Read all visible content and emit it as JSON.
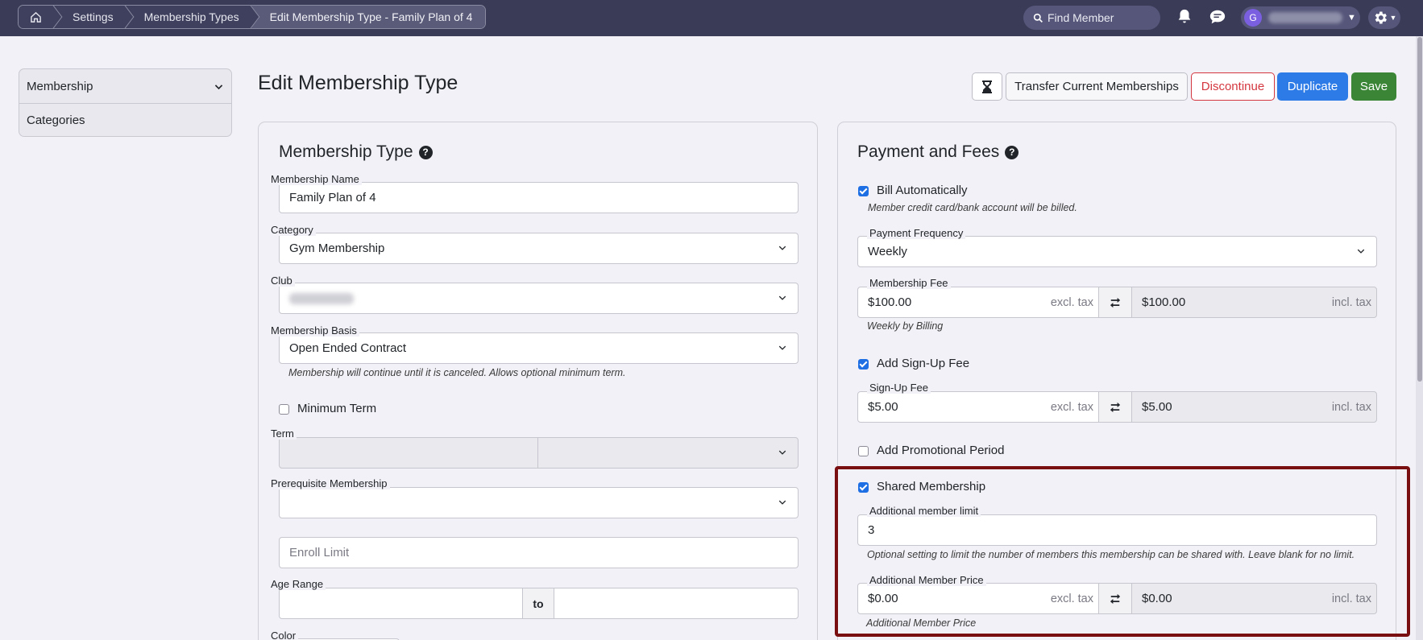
{
  "topbar": {
    "breadcrumbs": [
      "Settings",
      "Membership Types",
      "Edit Membership Type - Family Plan of 4"
    ],
    "search_placeholder": "Find Member",
    "user_initial": "G"
  },
  "sidebar": {
    "items": [
      {
        "label": "Membership"
      },
      {
        "label": "Categories"
      }
    ]
  },
  "page": {
    "title": "Edit Membership Type",
    "actions": {
      "transfer": "Transfer Current Memberships",
      "discontinue": "Discontinue",
      "duplicate": "Duplicate",
      "save": "Save"
    }
  },
  "membership_type": {
    "title": "Membership Type",
    "name_label": "Membership Name",
    "name_value": "Family Plan of 4",
    "category_label": "Category",
    "category_value": "Gym Membership",
    "club_label": "Club",
    "basis_label": "Membership Basis",
    "basis_value": "Open Ended Contract",
    "basis_hint": "Membership will continue until it is canceled. Allows optional minimum term.",
    "minimum_term_label": "Minimum Term",
    "minimum_term_checked": false,
    "term_label": "Term",
    "prerequisite_label": "Prerequisite Membership",
    "enroll_limit_placeholder": "Enroll Limit",
    "age_range_label": "Age Range",
    "age_range_to": "to",
    "color_label": "Color"
  },
  "payment": {
    "title": "Payment and Fees",
    "bill_auto_label": "Bill Automatically",
    "bill_auto_checked": true,
    "bill_auto_hint": "Member credit card/bank account will be billed.",
    "frequency_label": "Payment Frequency",
    "frequency_value": "Weekly",
    "fee_label": "Membership Fee",
    "fee_excl": "$100.00",
    "fee_incl": "$100.00",
    "excl_tax": "excl. tax",
    "incl_tax": "incl. tax",
    "fee_hint": "Weekly by Billing",
    "signup_label": "Add Sign-Up Fee",
    "signup_checked": true,
    "signup_fee_label": "Sign-Up Fee",
    "signup_excl": "$5.00",
    "signup_incl": "$5.00",
    "promo_label": "Add Promotional Period",
    "promo_checked": false,
    "shared_label": "Shared Membership",
    "shared_checked": true,
    "limit_label": "Additional member limit",
    "limit_value": "3",
    "limit_hint": "Optional setting to limit the number of members this membership can be shared with. Leave blank for no limit.",
    "addl_price_label": "Additional Member Price",
    "addl_excl": "$0.00",
    "addl_incl": "$0.00",
    "addl_hint": "Additional Member Price"
  },
  "colors": {
    "topbar": "#3a3b57",
    "primary": "#2d7be6",
    "success": "#3b8636",
    "danger": "#d4373f",
    "highlight_border": "#7a0f12"
  }
}
